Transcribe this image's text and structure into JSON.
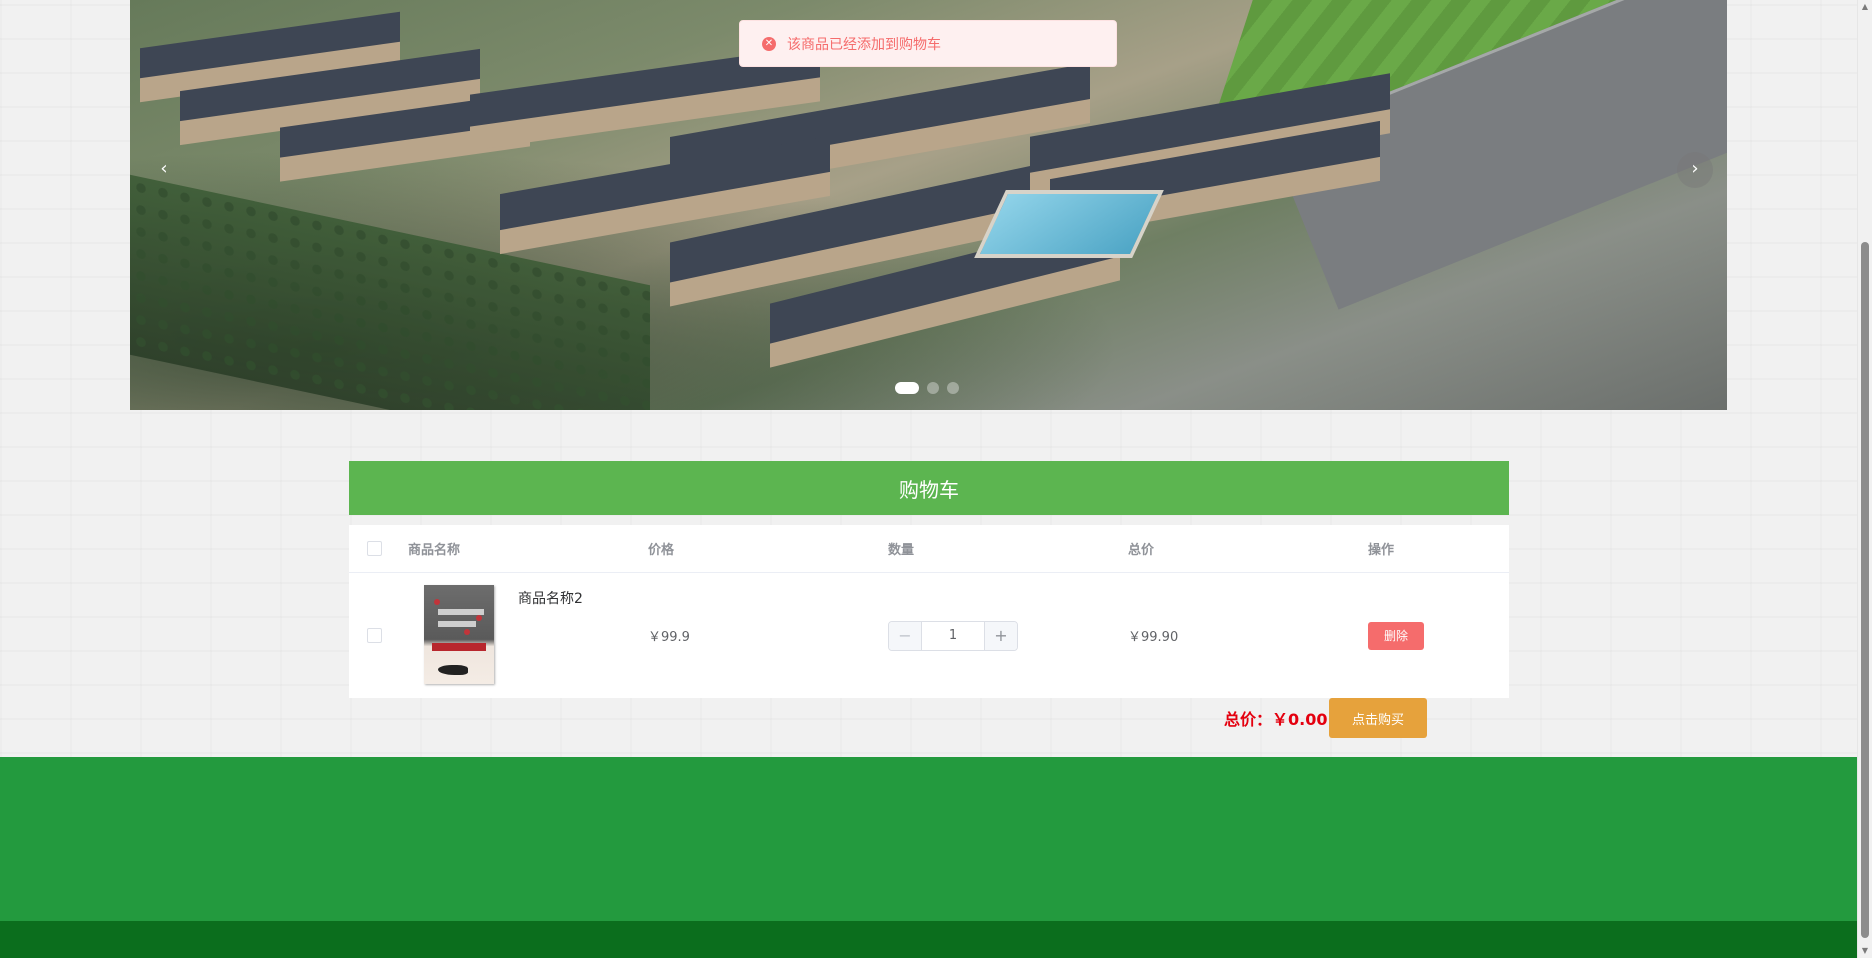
{
  "toast": {
    "message": "该商品已经添加到购物车",
    "icon": "error-circle-icon"
  },
  "carousel": {
    "prev_icon": "‹",
    "next_icon": "›",
    "slide_count": 3,
    "active_index": 0
  },
  "cart": {
    "title": "购物车",
    "columns": [
      "商品名称",
      "价格",
      "数量",
      "总价",
      "操作"
    ],
    "items": [
      {
        "name": "商品名称2",
        "price": "￥99.9",
        "quantity": "1",
        "total": "￥99.90",
        "delete_label": "删除"
      }
    ],
    "summary_label": "总价：",
    "summary_amount": "￥0.00",
    "buy_label": "点击购买"
  },
  "colors": {
    "cart_header": "#5cb550",
    "delete_button": "#f56c6c",
    "buy_button": "#e6a23c",
    "footer": "#239a3e",
    "footer_bottom": "#0b6e1d",
    "total_text": "#e4000f"
  }
}
